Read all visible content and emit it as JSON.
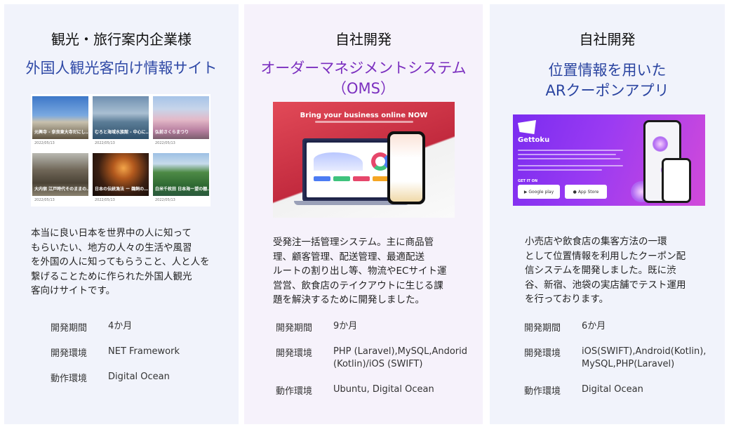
{
  "cards": [
    {
      "client": "観光・旅行案内企業様",
      "title_lines": [
        "外国人観光客向け情報サイト"
      ],
      "description": "本当に良い日本を世界中の人に知って\nもらいたい、地方の人々の生活や風習\nを外国の人に知ってもらうこと、人と人を\n繋げることために作られた外国人観光\n客向けサイトです。",
      "specs": [
        {
          "key": "開発期間",
          "value": "4か月"
        },
        {
          "key": "開発環境",
          "value": "NET Framework"
        },
        {
          "key": "動作環境",
          "value": "Digital Ocean"
        }
      ],
      "image": {
        "tiles": [
          {
            "caption": "元興寺 - 奈良東大寺だにし…",
            "meta": "2022/05/13"
          },
          {
            "caption": "むろと海域水族館 - 中心に…",
            "meta": "2022/05/13"
          },
          {
            "caption": "弘前さくらまつり",
            "meta": "2022/05/13"
          },
          {
            "caption": "大内宿 江戸時代そのままの…",
            "meta": "2022/05/13"
          },
          {
            "caption": "日本の伝統漁法 ー 鵜飼の…",
            "meta": "2022/05/13"
          },
          {
            "caption": "白米千枚田 日本海ー望の棚…",
            "meta": "2022/05/13"
          }
        ]
      }
    },
    {
      "client": "自社開発",
      "title_lines": [
        "オーダーマネジメントシステム",
        "（OMS）"
      ],
      "description": "受発注一括管理システム。主に商品管\n理、顧客管理、配送管理、最適配送\nルートの割り出し等、物流やECサイト運\n営営、飲食店のテイクアウトに生じる課\n題を解決するために開発しました。",
      "specs": [
        {
          "key": "開発期間",
          "value": "9か月"
        },
        {
          "key": "開発環境",
          "value": "PHP (Laravel),MySQL,Andorid\n(Kotlin)/iOS (SWIFT)"
        },
        {
          "key": "動作環境",
          "value": "Ubuntu, Digital Ocean"
        }
      ],
      "image": {
        "headline": "Bring your business online NOW"
      }
    },
    {
      "client": "自社開発",
      "title_lines": [
        "位置情報を用いた",
        "ARクーポンアプリ"
      ],
      "description": "小売店や飲食店の集客方法の一環\nとして位置情報を利用したクーポン配\n信システムを開発しました。既に渋\n谷、新宿、池袋の実店舗でテスト運用\nを行っております。",
      "specs": [
        {
          "key": "開発期間",
          "value": "6か月"
        },
        {
          "key": "開発環境",
          "value": "iOS(SWIFT),Android(Kotlin),\nMySQL,PHP(Laravel)"
        },
        {
          "key": "動作環境",
          "value": "Digital Ocean"
        }
      ],
      "image": {
        "brand": "Gettoku",
        "get_it_on": "GET IT ON",
        "google_play": "Google play",
        "app_store": "App Store"
      }
    }
  ],
  "colors": {
    "card_bg_blue": "#f1f3fb",
    "card_bg_purple": "#f6f2fb",
    "title_blue": "#2f49a6",
    "title_purple": "#7b2fbf"
  }
}
